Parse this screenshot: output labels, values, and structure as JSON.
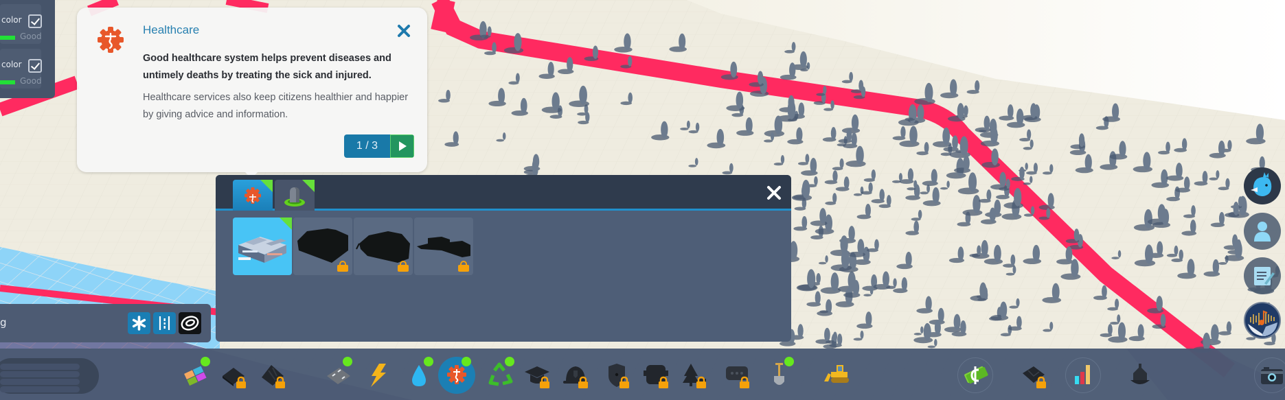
{
  "info_panel": {
    "rows": [
      {
        "label": "color",
        "checked": true,
        "status": "Good",
        "status_color": "#22e037"
      },
      {
        "label": "color",
        "checked": true,
        "status": "Good",
        "status_color": "#22e037"
      }
    ]
  },
  "tutorial": {
    "icon": "healthcare-icon",
    "title": "Healthcare",
    "body_bold": "Good healthcare system helps prevent diseases and untimely deaths by treating the sick and injured.",
    "body": "Healthcare services also keep citizens healthier and happier by giving advice and information.",
    "page_current": 1,
    "page_total": 3,
    "pager_label": "1 / 3",
    "close_icon": "close-icon",
    "next_icon": "play-next-icon"
  },
  "building_panel": {
    "tabs": [
      {
        "name": "healthcare",
        "icon": "healthcare-icon",
        "active": true,
        "new": true
      },
      {
        "name": "deathcare",
        "icon": "gravestone-icon",
        "active": false,
        "new": true
      }
    ],
    "items": [
      {
        "name": "hospital",
        "icon": "hospital-building-icon",
        "selected": true,
        "locked": false,
        "new": true
      },
      {
        "name": "locked-building-1",
        "icon": "locked-silhouette-icon",
        "selected": false,
        "locked": true
      },
      {
        "name": "locked-building-2",
        "icon": "locked-silhouette-icon",
        "selected": false,
        "locked": true
      },
      {
        "name": "locked-building-3",
        "icon": "locked-silhouette-icon",
        "selected": false,
        "locked": true
      }
    ],
    "close_icon": "close-icon"
  },
  "snap_bar": {
    "label": "g",
    "buttons": [
      {
        "name": "snap-all",
        "icon": "asterisk-icon",
        "active": true
      },
      {
        "name": "snap-grid",
        "icon": "guideline-icon",
        "active": true
      },
      {
        "name": "snap-contour",
        "icon": "contour-icon",
        "active": false
      }
    ]
  },
  "toolbar": {
    "items": [
      {
        "name": "zoning",
        "icon": "zoning-icon",
        "locked": false,
        "new": true
      },
      {
        "name": "areas",
        "icon": "area-icon",
        "locked": true,
        "new": false
      },
      {
        "name": "landscaping",
        "icon": "terrain-icon",
        "locked": true,
        "new": false
      },
      {
        "name": "roads",
        "icon": "road-icon",
        "locked": false,
        "new": true
      },
      {
        "name": "electricity",
        "icon": "lightning-icon",
        "locked": false,
        "new": false
      },
      {
        "name": "water",
        "icon": "water-drop-icon",
        "locked": false,
        "new": true
      },
      {
        "name": "healthcare",
        "icon": "healthcare-icon",
        "locked": false,
        "new": true,
        "active": true
      },
      {
        "name": "garbage",
        "icon": "recycle-icon",
        "locked": false,
        "new": true
      },
      {
        "name": "education",
        "icon": "graduation-cap-icon",
        "locked": true,
        "new": false
      },
      {
        "name": "fire",
        "icon": "fire-helmet-icon",
        "locked": true,
        "new": false
      },
      {
        "name": "police",
        "icon": "police-badge-icon",
        "locked": true,
        "new": false
      },
      {
        "name": "transportation",
        "icon": "bus-icon",
        "locked": true,
        "new": false
      },
      {
        "name": "parks",
        "icon": "tree-icon",
        "locked": true,
        "new": false
      },
      {
        "name": "communications",
        "icon": "chat-bubble-icon",
        "locked": true,
        "new": false
      },
      {
        "name": "landscape-tools",
        "icon": "shovel-icon",
        "locked": false,
        "new": true
      },
      {
        "name": "bulldozer",
        "icon": "bulldozer-icon",
        "locked": false,
        "new": false
      },
      {
        "name": "economy",
        "icon": "money-icon",
        "locked": false,
        "new": false
      },
      {
        "name": "map-tiles",
        "icon": "map-tile-icon",
        "locked": true,
        "new": false
      },
      {
        "name": "statistics",
        "icon": "bar-chart-icon",
        "locked": false,
        "new": false
      },
      {
        "name": "city-services",
        "icon": "city-hall-icon",
        "locked": false,
        "new": false
      },
      {
        "name": "photo-mode",
        "icon": "camera-icon",
        "locked": false,
        "new": false
      }
    ]
  },
  "side_buttons": [
    {
      "name": "chirper",
      "icon": "bird-icon"
    },
    {
      "name": "citizens",
      "icon": "person-icon"
    },
    {
      "name": "journal",
      "icon": "notepad-icon"
    },
    {
      "name": "radio",
      "icon": "radio-icon"
    }
  ],
  "colors": {
    "road_highlight": "#ff2a60",
    "accent_blue": "#2190cc",
    "new_indicator": "#66e81e",
    "lock": "#f5a10a",
    "healthcare": "#e8572a"
  }
}
